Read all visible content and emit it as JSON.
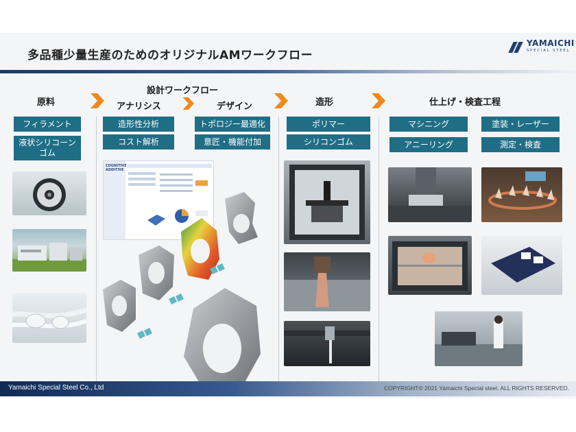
{
  "title": "多品種少量生産のためのオリジナルAMワークフロー",
  "logo": {
    "name": "YAMAICHI",
    "sub": "SPECIAL STEEL"
  },
  "stages": {
    "raw": "原料",
    "design_workflow": "設計ワークフロー",
    "analysis": "アナリシス",
    "design": "デザイン",
    "molding": "造形",
    "finishing": "仕上げ・検査工程"
  },
  "raw_items": [
    "フィラメント",
    "液状シリコーンゴム"
  ],
  "analysis_items": [
    "造形性分析",
    "コスト解析"
  ],
  "design_items": [
    "トポロジー最適化",
    "意匠・機能付加"
  ],
  "molding_items": [
    "ポリマー",
    "シリコンゴム"
  ],
  "finishing_items": [
    "マシニング",
    "塗装・レーザー",
    "アニーリング",
    "測定・検査"
  ],
  "software_ui": {
    "brand_line1": "COGNITIVE",
    "brand_line2": "ADDITIVE"
  },
  "footer": {
    "company": "Yamaichi Special Steel Co., Ltd",
    "copyright": "COPYRIGHT© 2021 Yamaichi Special steel. ALL RIGHTS RESERVED."
  },
  "colors": {
    "box": "#1f6e86",
    "arrow": "#f08a1c",
    "navy": "#1a3966"
  }
}
